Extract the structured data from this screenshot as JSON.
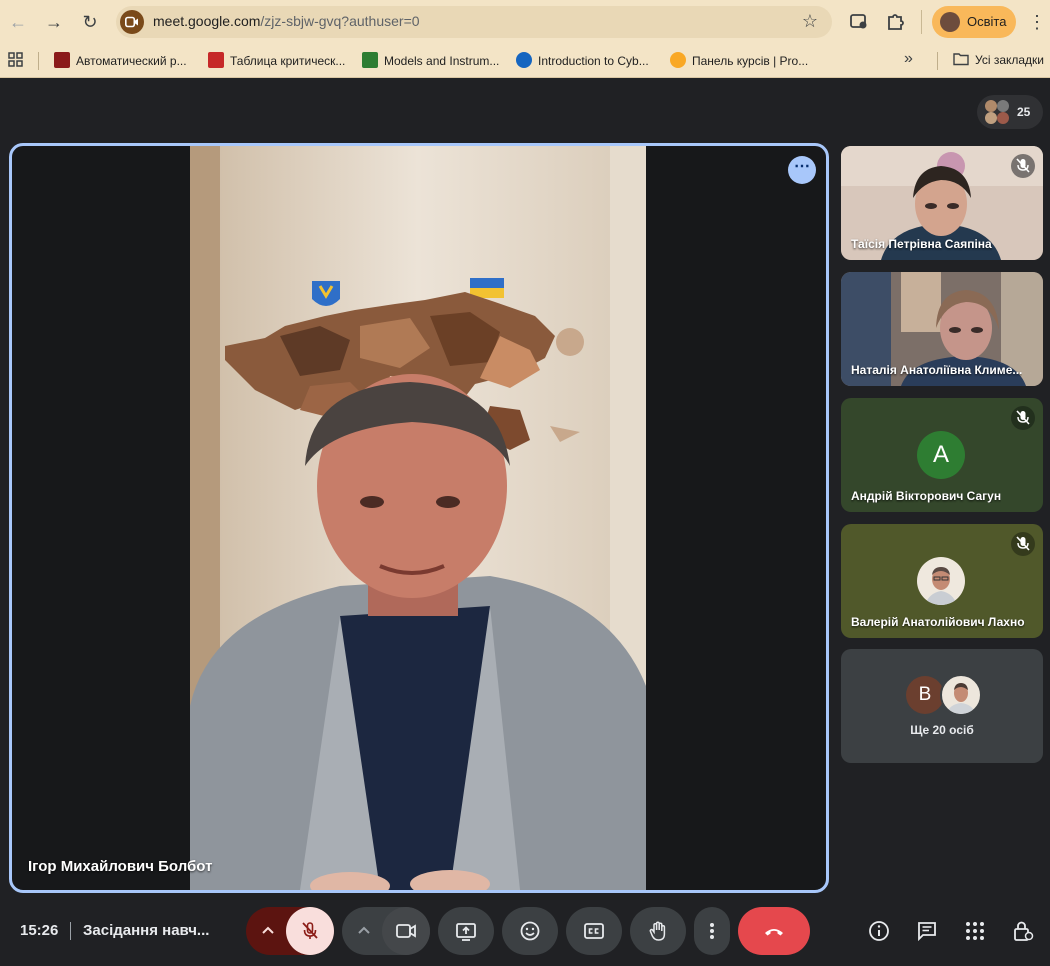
{
  "browser": {
    "url_main": "meet.google.com",
    "url_path": "/zjz-sbjw-gvq?authuser=0",
    "profile_label": "Освіта",
    "bookmarks": [
      {
        "label": "Автоматический р...",
        "color": "#8b1a1a"
      },
      {
        "label": "Таблица критическ...",
        "color": "#c62828"
      },
      {
        "label": "Models and Instrum...",
        "color": "#2e7d32"
      },
      {
        "label": "Introduction to Cyb...",
        "color": "#1565c0"
      },
      {
        "label": "Панель курсів | Pro...",
        "color": "#f9a825"
      }
    ],
    "all_bookmarks_label": "Усі закладки"
  },
  "meet": {
    "participant_count": "25",
    "main_speaker": "Ігор Михайлович Болбот",
    "tiles": [
      {
        "name": "Таїсія Петрівна Саяпіна",
        "muted": true
      },
      {
        "name": "Наталія Анатоліївна Климе...",
        "muted": false
      },
      {
        "name": "Андрій Вікторович Сагун",
        "muted": true,
        "initial": "A"
      },
      {
        "name": "Валерій Анатолійович Лахно",
        "muted": true
      }
    ],
    "more_people": {
      "initial": "B",
      "label": "Ще 20 осіб"
    },
    "time": "15:26",
    "meeting_title": "Засідання навч..."
  },
  "colors": {
    "accent_blue": "#a8c7fa",
    "end_call_red": "#e5484d",
    "mic_off_pink": "#f9dedc",
    "mic_off_dark": "#8c1d18",
    "tile_green": "#34472b",
    "tile_olive": "#50582a"
  }
}
